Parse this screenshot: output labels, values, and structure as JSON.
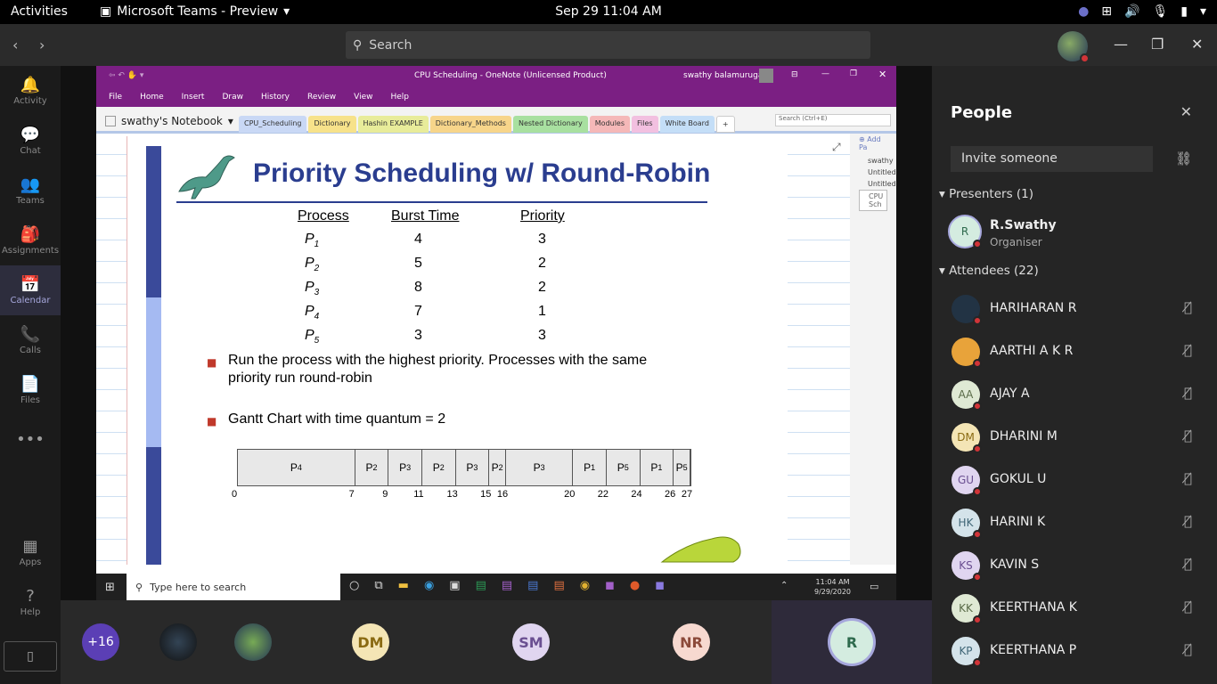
{
  "os_bar": {
    "activities": "Activities",
    "app_name": "Microsoft Teams - Preview",
    "clock": "Sep 29  11:04 AM"
  },
  "teams": {
    "search_placeholder": "Search",
    "rail": [
      {
        "label": "Activity",
        "icon": "bell-icon",
        "glyph": "🔔"
      },
      {
        "label": "Chat",
        "icon": "chat-icon",
        "glyph": "💬"
      },
      {
        "label": "Teams",
        "icon": "teams-icon",
        "glyph": "👥"
      },
      {
        "label": "Assignments",
        "icon": "bag-icon",
        "glyph": "🎒"
      },
      {
        "label": "Calendar",
        "icon": "calendar-icon",
        "glyph": "📅"
      },
      {
        "label": "Calls",
        "icon": "phone-icon",
        "glyph": "📞"
      },
      {
        "label": "Files",
        "icon": "file-icon",
        "glyph": "📄"
      },
      {
        "label": "",
        "icon": "more-icon",
        "glyph": "•••"
      },
      {
        "label": "Apps",
        "icon": "apps-icon",
        "glyph": "▦"
      },
      {
        "label": "Help",
        "icon": "help-icon",
        "glyph": "?"
      }
    ]
  },
  "onenote": {
    "title": "CPU Scheduling  -  OneNote (Unlicensed Product)",
    "user": "swathy balamurugan",
    "menu": [
      "File",
      "Home",
      "Insert",
      "Draw",
      "History",
      "Review",
      "View",
      "Help"
    ],
    "notebook": "swathy's Notebook",
    "tabs": [
      {
        "label": "CPU_Scheduling",
        "color": "#c9d8f5"
      },
      {
        "label": "Dictionary",
        "color": "#f7e28a"
      },
      {
        "label": "Hashin EXAMPLE",
        "color": "#e8ec9a"
      },
      {
        "label": "Dictionary_Methods",
        "color": "#f7d58a"
      },
      {
        "label": "Nested Dictionary",
        "color": "#a8e0a0"
      },
      {
        "label": "Modules",
        "color": "#f5b8b8"
      },
      {
        "label": "Files",
        "color": "#f2c0e0"
      },
      {
        "label": "White Board",
        "color": "#c4def7"
      }
    ],
    "search_placeholder": "Search (Ctrl+E)",
    "add_page": "Add Pa",
    "pages": [
      "swathy",
      "Untitled",
      "Untitled",
      "CPU Sch"
    ]
  },
  "slide": {
    "title": "Priority Scheduling w/ Round-Robin",
    "headers": [
      "Process",
      "Burst Time",
      "Priority"
    ],
    "rows": [
      {
        "p": "P",
        "sub": "1",
        "burst": "4",
        "prio": "3"
      },
      {
        "p": "P",
        "sub": "2",
        "burst": "5",
        "prio": "2"
      },
      {
        "p": "P",
        "sub": "3",
        "burst": "8",
        "prio": "2"
      },
      {
        "p": "P",
        "sub": "4",
        "burst": "7",
        "prio": "1"
      },
      {
        "p": "P",
        "sub": "5",
        "burst": "3",
        "prio": "3"
      }
    ],
    "bullet1_line1": "Run the process with the highest priority. Processes with the same",
    "bullet1_line2": "priority run round-robin",
    "bullet2": "Gantt Chart with time quantum = 2",
    "gantt": [
      {
        "sub": "4",
        "start": 0,
        "end": 7
      },
      {
        "sub": "2",
        "start": 7,
        "end": 9
      },
      {
        "sub": "3",
        "start": 9,
        "end": 11
      },
      {
        "sub": "2",
        "start": 11,
        "end": 13
      },
      {
        "sub": "3",
        "start": 13,
        "end": 15
      },
      {
        "sub": "2",
        "start": 15,
        "end": 16
      },
      {
        "sub": "3",
        "start": 16,
        "end": 20
      },
      {
        "sub": "1",
        "start": 20,
        "end": 22
      },
      {
        "sub": "5",
        "start": 22,
        "end": 24
      },
      {
        "sub": "1",
        "start": 24,
        "end": 26
      },
      {
        "sub": "5",
        "start": 26,
        "end": 27
      }
    ],
    "ticks": [
      "0",
      "7",
      "9",
      "11",
      "13",
      "15",
      "16",
      "20",
      "22",
      "24",
      "26",
      "27"
    ]
  },
  "windows_taskbar": {
    "search_placeholder": "Type here to search",
    "time": "11:04 AM",
    "date": "9/29/2020"
  },
  "people": {
    "title": "People",
    "invite": "Invite someone",
    "presenters_label": "Presenters (1)",
    "presenter": {
      "name": "R.Swathy",
      "role": "Organiser",
      "initials": "R"
    },
    "attendees_label": "Attendees (22)",
    "attendees": [
      {
        "name": "HARIHARAN R",
        "initials": "",
        "bg": "#234"
      },
      {
        "name": "AARTHI A K R",
        "initials": "",
        "bg": "#e8a33a"
      },
      {
        "name": "AJAY A",
        "initials": "AA",
        "bg": "#dfe9d4",
        "fg": "#5a6b48"
      },
      {
        "name": "DHARINI M",
        "initials": "DM",
        "bg": "#f4e5b5",
        "fg": "#8a6a12"
      },
      {
        "name": "GOKUL U",
        "initials": "GU",
        "bg": "#e0d5f0",
        "fg": "#6a4f91"
      },
      {
        "name": "HARINI K",
        "initials": "HK",
        "bg": "#d4e3ea",
        "fg": "#3f6576"
      },
      {
        "name": "KAVIN S",
        "initials": "KS",
        "bg": "#e0d5f0",
        "fg": "#6a4f91"
      },
      {
        "name": "KEERTHANA K",
        "initials": "KK",
        "bg": "#dfe9d4",
        "fg": "#5a6b48"
      },
      {
        "name": "KEERTHANA P",
        "initials": "KP",
        "bg": "#d4e3ea",
        "fg": "#3f6576"
      }
    ]
  },
  "strip": {
    "overflow": "+16",
    "tiles": [
      {
        "initials": "DM",
        "bg": "#f4e5b5",
        "fg": "#8a6a12"
      },
      {
        "initials": "SM",
        "bg": "#e0d5f0",
        "fg": "#6a4f91"
      },
      {
        "initials": "NR",
        "bg": "#f7d9d0",
        "fg": "#8c4a3a"
      },
      {
        "initials": "R",
        "bg": "#d4ece0",
        "fg": "#2e6a4d"
      }
    ]
  }
}
